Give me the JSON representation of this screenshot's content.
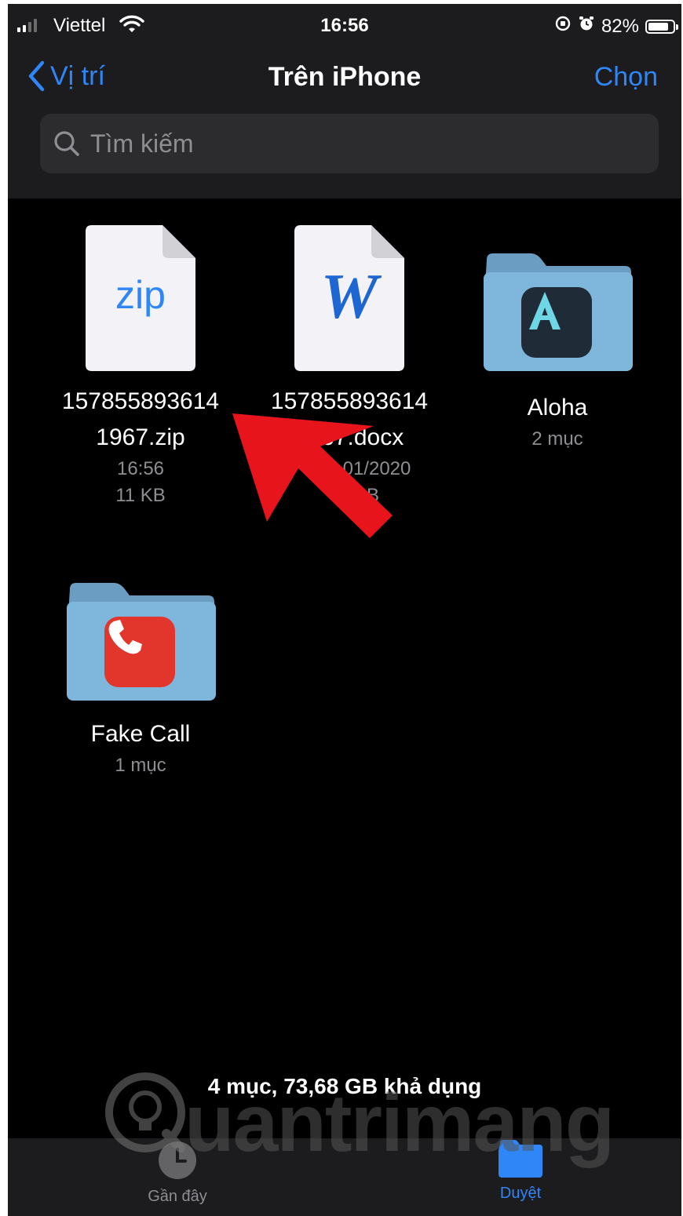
{
  "status_bar": {
    "carrier": "Viettel",
    "time": "16:56",
    "battery_percent": "82%",
    "battery_level": 0.82,
    "signal_bars": 2
  },
  "nav": {
    "back_label": "Vị trí",
    "title": "Trên iPhone",
    "select_label": "Chọn"
  },
  "search": {
    "placeholder": "Tìm kiếm"
  },
  "items": [
    {
      "name_line1": "157855893614",
      "name_line2": "1967.zip",
      "meta_line1": "16:56",
      "meta_line2": "11 KB",
      "icon": "zip-file-icon",
      "icon_label": "zip"
    },
    {
      "name_line1": "157855893614",
      "name_line2": "1967.docx",
      "meta_line1": "01/2020",
      "meta_line2": "B",
      "icon": "word-file-icon",
      "icon_label": "W"
    },
    {
      "name_line1": "Aloha",
      "meta_line1": "2 mục",
      "icon": "folder-icon",
      "app_icon": "aloha-app-icon",
      "app_letter": "A"
    },
    {
      "name_line1": "Fake Call",
      "meta_line1": "1 mục",
      "icon": "folder-icon",
      "app_icon": "phone-app-icon"
    }
  ],
  "footer": {
    "summary": "4 mục, 73,68 GB khả dụng"
  },
  "tab_bar": {
    "recent_label": "Gần đây",
    "browse_label": "Duyệt"
  },
  "watermark": {
    "text": "uantrimang"
  },
  "colors": {
    "accent": "#2f86f7",
    "background": "#000000",
    "bar_background": "#1c1c1e",
    "secondary_text": "#8e8e93",
    "folder": "#7fb6dc",
    "annotation_arrow": "#e8141c"
  }
}
